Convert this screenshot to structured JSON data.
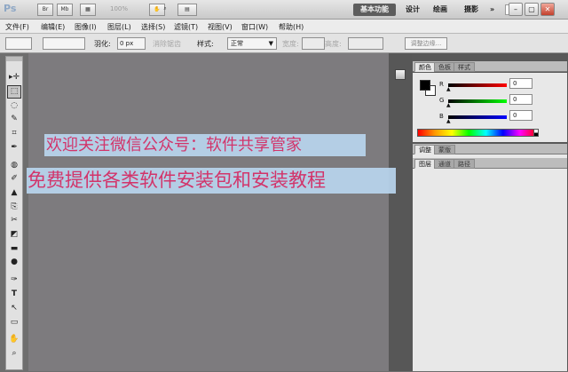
{
  "app": {
    "logo": "Ps",
    "zoom": "100%",
    "workspaces": [
      "基本功能",
      "设计",
      "绘画",
      "摄影"
    ],
    "more": "»",
    "window_controls": {
      "minimize": "–",
      "restore": "▢",
      "close": "✕"
    }
  },
  "menus": [
    "文件(F)",
    "编辑(E)",
    "图像(I)",
    "图层(L)",
    "选择(S)",
    "滤镜(T)",
    "视图(V)",
    "窗口(W)",
    "帮助(H)"
  ],
  "options": {
    "feather_label": "羽化:",
    "feather_value": "0 px",
    "antialias": "消除锯齿",
    "style_label": "样式:",
    "style_value": "正常",
    "width_label": "宽度:",
    "height_label": "高度:",
    "refine_edge": "调整边缘..."
  },
  "toolbox": {
    "tools": [
      "▸✛",
      "⬚",
      "◌",
      "✎",
      "⌗",
      "✒",
      "◍",
      "✐",
      "▲",
      "⎘",
      "✂",
      "◩",
      "▬",
      "●",
      "✷",
      "✑",
      "T",
      "↖",
      "▭",
      "✋",
      "⌕"
    ]
  },
  "panels": {
    "color_tabs": [
      "颜色",
      "色板",
      "样式"
    ],
    "channels": [
      {
        "label": "R",
        "value": "0"
      },
      {
        "label": "G",
        "value": "0"
      },
      {
        "label": "B",
        "value": "0"
      }
    ],
    "adjust_tabs": [
      "调整",
      "蒙版"
    ],
    "layer_tabs": [
      "图层",
      "通道",
      "路径"
    ]
  },
  "overlay": {
    "line1": "欢迎关注微信公众号：软件共享管家",
    "line2": "免费提供各类软件安装包和安装教程"
  }
}
